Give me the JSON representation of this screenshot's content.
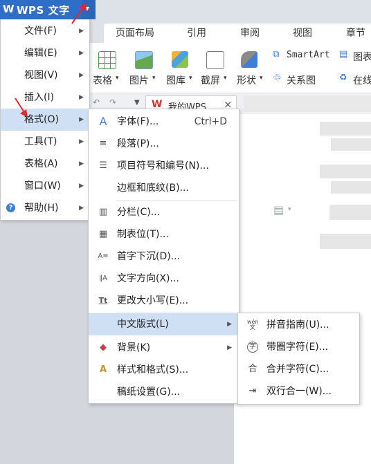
{
  "app": {
    "logo": "W",
    "title": "WPS 文字",
    "dropdown_icon": "▾"
  },
  "ribbon_tabs": [
    "页面布局",
    "引用",
    "审阅",
    "视图",
    "章节"
  ],
  "ribbon": {
    "table": "表格",
    "picture": "图片",
    "gallery": "图库",
    "screenshot": "截屏",
    "shape": "形状",
    "smartart": "SmartArt",
    "chart": "图表",
    "relation": "关系图",
    "online": "在线"
  },
  "doc_tab": {
    "label": "我的WPS",
    "close": "×"
  },
  "main_menu": [
    {
      "label": "文件(F)"
    },
    {
      "label": "编辑(E)"
    },
    {
      "label": "视图(V)"
    },
    {
      "label": "插入(I)"
    },
    {
      "label": "格式(O)"
    },
    {
      "label": "工具(T)"
    },
    {
      "label": "表格(A)"
    },
    {
      "label": "窗口(W)"
    },
    {
      "label": "帮助(H)"
    }
  ],
  "format_menu": [
    {
      "label": "字体(F)...",
      "shortcut": "Ctrl+D",
      "icon": "A"
    },
    {
      "label": "段落(P)...",
      "icon": "≡"
    },
    {
      "label": "项目符号和编号(N)...",
      "icon": "☰"
    },
    {
      "label": "边框和底纹(B)..."
    },
    {
      "label": "分栏(C)...",
      "icon": "▥"
    },
    {
      "label": "制表位(T)...",
      "icon": "▦"
    },
    {
      "label": "首字下沉(D)...",
      "icon": "A≡"
    },
    {
      "label": "文字方向(X)...",
      "icon": "‖A"
    },
    {
      "label": "更改大小写(E)...",
      "icon": "Tt"
    },
    {
      "label": "中文版式(L)"
    },
    {
      "label": "背景(K)",
      "icon": "◆"
    },
    {
      "label": "样式和格式(S)...",
      "icon": "A"
    },
    {
      "label": "稿纸设置(G)..."
    }
  ],
  "chinese_layout_menu": [
    {
      "label": "拼音指南(U)...",
      "icon": "wén 文"
    },
    {
      "label": "带圈字符(E)...",
      "icon": "字"
    },
    {
      "label": "合并字符(C)...",
      "icon": "合"
    },
    {
      "label": "双行合一(W)...",
      "icon": "⇥"
    }
  ],
  "colors": {
    "brand": "#2f6ec7",
    "highlight": "#cfe0f4",
    "arrow": "#e02a2a"
  }
}
